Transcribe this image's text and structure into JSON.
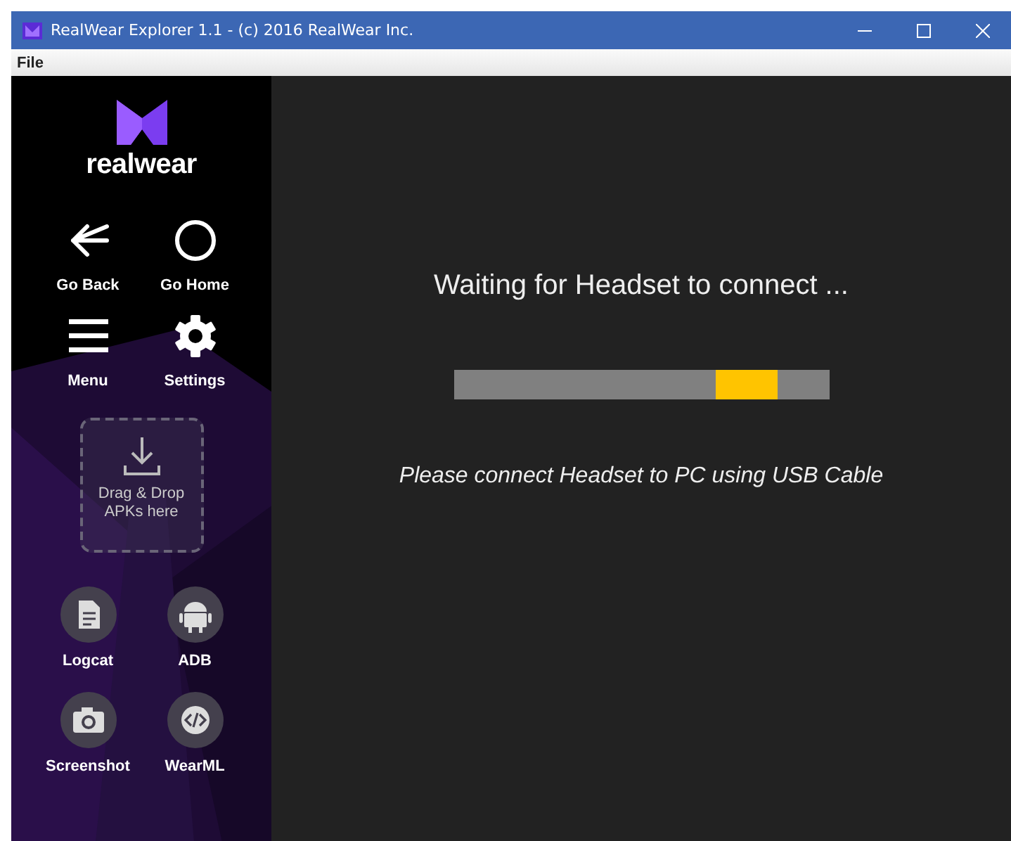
{
  "window": {
    "title": "RealWear Explorer 1.1 - (c) 2016 RealWear Inc."
  },
  "menu_bar": [
    "File"
  ],
  "sidebar": {
    "logo_text": "realwear",
    "nav_buttons": [
      {
        "label": "Go Back"
      },
      {
        "label": "Go Home"
      },
      {
        "label": "Menu"
      },
      {
        "label": "Settings"
      }
    ],
    "drop_zone": {
      "label": "Drag & Drop APKs here"
    },
    "tools": [
      {
        "label": "Logcat"
      },
      {
        "label": "ADB"
      },
      {
        "label": "Screenshot"
      },
      {
        "label": "WearML"
      }
    ]
  },
  "main": {
    "heading": "Waiting for Headset to connect ...",
    "progress": {
      "indeterminate": true
    },
    "hint": "Please connect Headset to PC using USB Cable"
  }
}
